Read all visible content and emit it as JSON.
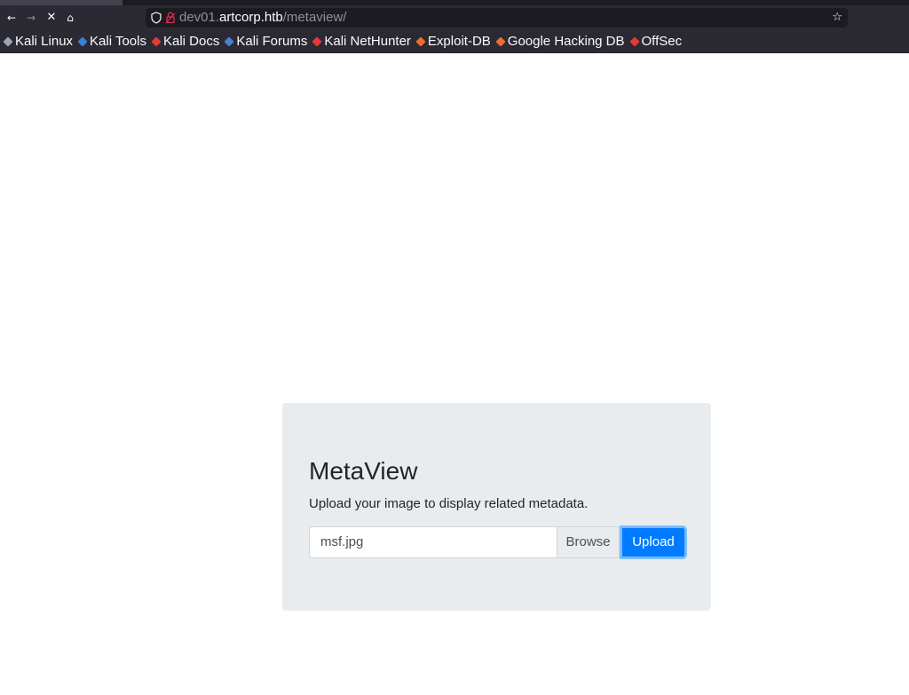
{
  "browser": {
    "url_prefix": "dev01.",
    "url_host": "artcorp.htb",
    "url_path": "/metaview/",
    "nav": {
      "back_icon": "←",
      "forward_icon": "→",
      "stop_icon": "✕",
      "home_icon": "⌂",
      "star_icon": "☆"
    },
    "bookmarks": [
      {
        "label": "Kali Linux",
        "icon": "kali-linux-icon",
        "color": "#9aa4b1"
      },
      {
        "label": "Kali Tools",
        "icon": "kali-tools-icon",
        "color": "#3b7dd8"
      },
      {
        "label": "Kali Docs",
        "icon": "kali-docs-icon",
        "color": "#e53935"
      },
      {
        "label": "Kali Forums",
        "icon": "kali-forums-icon",
        "color": "#4a7fd6"
      },
      {
        "label": "Kali NetHunter",
        "icon": "kali-nethunter-icon",
        "color": "#e53935"
      },
      {
        "label": "Exploit-DB",
        "icon": "exploit-db-icon",
        "color": "#ef6c2f"
      },
      {
        "label": "Google Hacking DB",
        "icon": "google-hacking-db-icon",
        "color": "#ef6c2f"
      },
      {
        "label": "OffSec",
        "icon": "offsec-icon",
        "color": "#e53935"
      }
    ]
  },
  "page": {
    "title": "MetaView",
    "lead": "Upload your image to display related metadata.",
    "file_name": "msf.jpg",
    "browse_label": "Browse",
    "upload_label": "Upload",
    "colors": {
      "primary": "#007bff",
      "jumbotron_bg": "#e9ecef",
      "text": "#212529"
    }
  }
}
